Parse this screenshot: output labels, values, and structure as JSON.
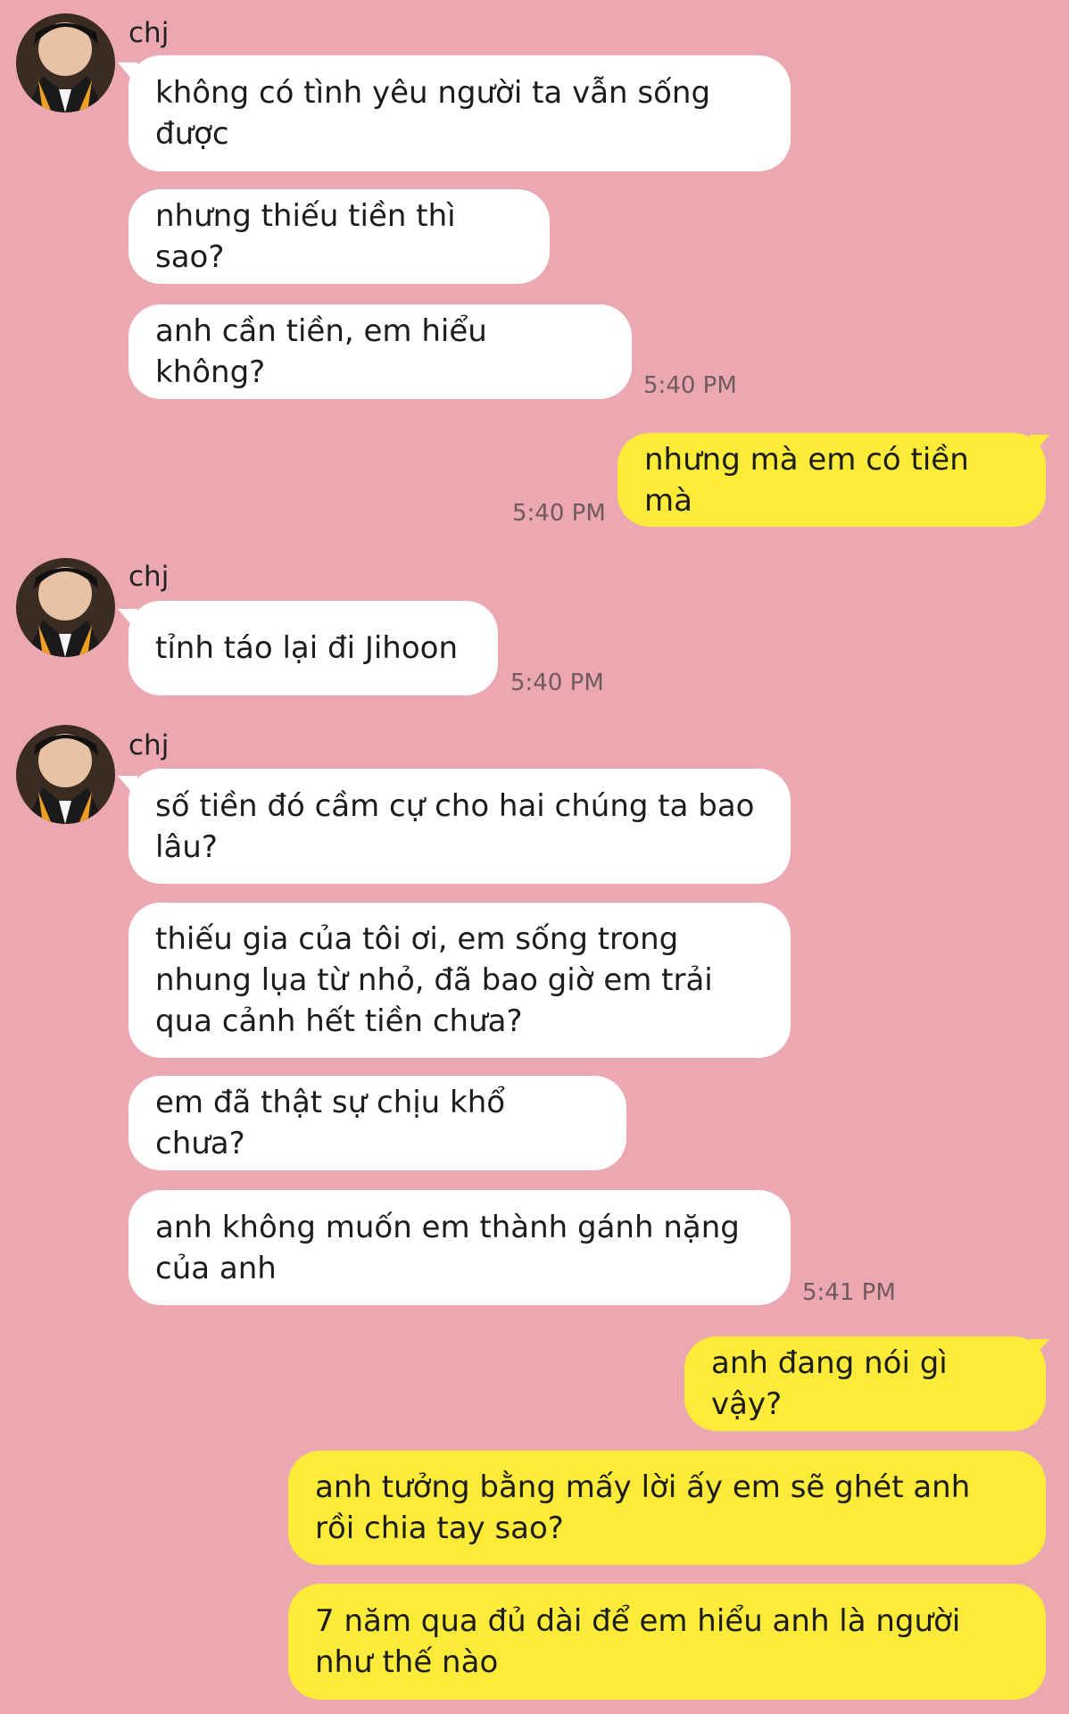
{
  "chat": {
    "sender_name": "chj",
    "messages": [
      {
        "text": "không có tình yêu người ta vẫn sống được"
      },
      {
        "text": "nhưng thiếu tiền thì sao?"
      },
      {
        "text": "anh cần tiền, em hiểu không?",
        "time": "5:40 PM"
      },
      {
        "text": "nhưng mà em có tiền mà",
        "time": "5:40 PM"
      },
      {
        "text": "tỉnh táo lại đi Jihoon",
        "time": "5:40 PM"
      },
      {
        "text": "số tiền đó cầm cự cho hai chúng ta bao lâu?"
      },
      {
        "text": "thiếu gia của tôi ơi, em sống trong nhung lụa từ nhỏ, đã bao giờ em trải qua cảnh hết tiền chưa?"
      },
      {
        "text": "em đã thật sự chịu khổ chưa?"
      },
      {
        "text": "anh không muốn em thành gánh nặng của anh",
        "time": "5:41 PM"
      },
      {
        "text": "anh đang nói gì vậy?"
      },
      {
        "text": "anh tưởng bằng mấy lời ấy em sẽ ghét anh rồi chia tay sao?"
      },
      {
        "text": "7 năm qua đủ dài để em hiểu anh là người như thế nào"
      }
    ]
  },
  "colors": {
    "background": "#eba8b0",
    "incoming_bubble": "#ffffff",
    "outgoing_bubble": "#fdeb3a"
  }
}
